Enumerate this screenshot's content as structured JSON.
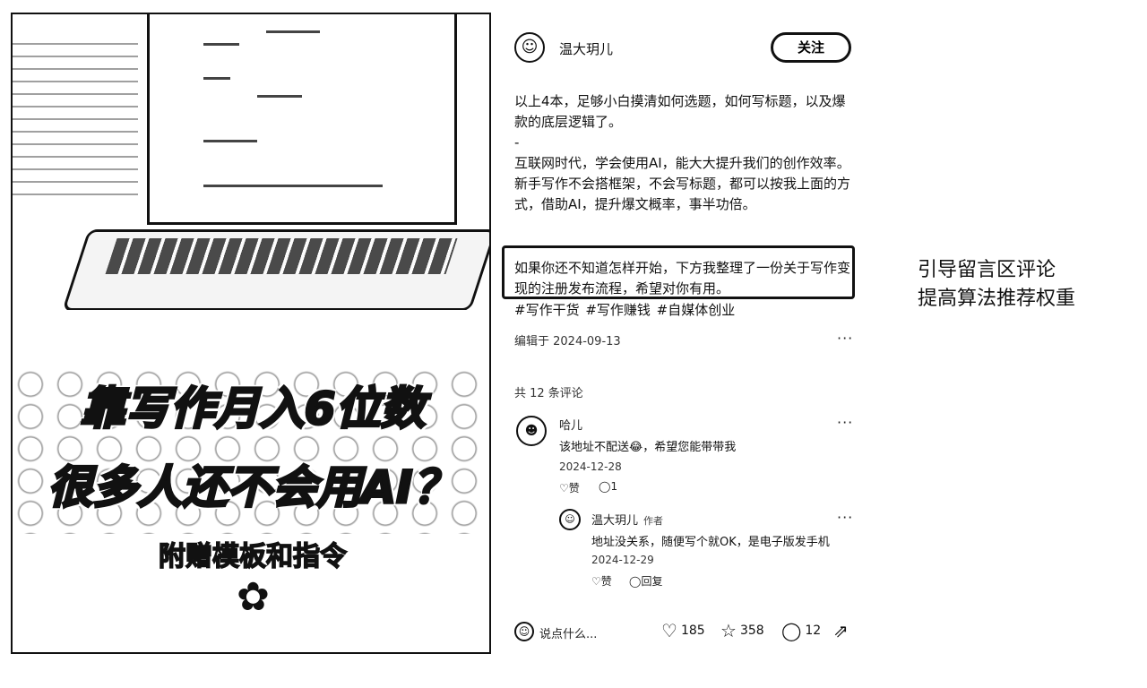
{
  "image": {
    "title_line1": "靠写作月入6位数",
    "title_line2": "很多人还不会用AI？",
    "subtitle": "附赠模板和指令"
  },
  "post": {
    "author": "温大玥儿",
    "follow_label": "关注",
    "paragraphs": [
      "以上4本，足够小白摸清如何选题，如何写标题，以及爆款的底层逻辑了。",
      "-",
      "互联网时代，学会使用AI，能大大提升我们的创作效率。",
      "新手写作不会搭框架，不会写标题，都可以按我上面的方式，借助AI，提升爆文概率，事半功倍。"
    ],
    "highlighted": "如果你还不知道怎样开始，下方我整理了一份关于写作变现的注册发布流程，希望对你有用。",
    "tags": "#写作干货 #写作赚钱 #自媒体创业",
    "edited": "编辑于 2024-09-13",
    "more": "···",
    "comment_count": "共 12 条评论"
  },
  "comments": [
    {
      "name": "哈儿",
      "text": "该地址不配送😂，希望您能带带我",
      "date": "2024-12-28",
      "like_label": "赞",
      "reply_count": "1"
    }
  ],
  "reply": {
    "name": "温大玥儿",
    "author_tag": "作者",
    "text": "地址没关系，随便写个就OK，是电子版发手机",
    "date": "2024-12-29",
    "like_label": "赞",
    "reply_label": "回复"
  },
  "bottom_bar": {
    "input_placeholder": "说点什么...",
    "likes": "185",
    "favorites": "358",
    "comments": "12"
  },
  "annotation": {
    "line1": "引导留言区评论",
    "line2": "提高算法推荐权重"
  },
  "icons": [
    "heart-icon",
    "star-icon",
    "comment-icon",
    "share-icon",
    "more-icon"
  ]
}
